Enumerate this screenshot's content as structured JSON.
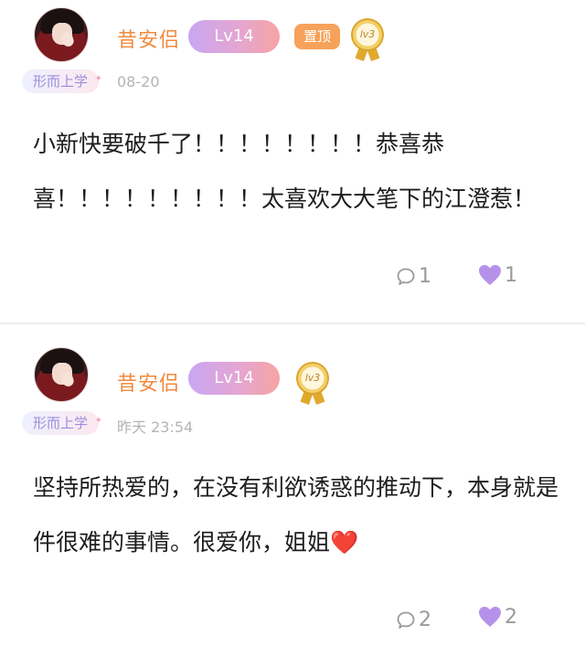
{
  "comments": [
    {
      "username": "昔安侣",
      "level": "Lv14",
      "pin_label": "置顶",
      "medal_text": "lv3",
      "tag": "形而上学",
      "time": "08-20",
      "text": "小新快要破千了！！！！！！！！恭喜恭喜！！！！！！！！！太喜欢大大笔下的江澄惹！",
      "reply_count": "1",
      "like_count": "1"
    },
    {
      "username": "昔安侣",
      "level": "Lv14",
      "medal_text": "lv3",
      "tag": "形而上学",
      "time": "昨天 23:54",
      "text": "坚持所热爱的，在没有利欲诱惑的推动下，本身就是件很难的事情。很爱你，姐姐❤️",
      "reply_count": "2",
      "like_count": "2"
    }
  ],
  "colors": {
    "username": "#f08a3e",
    "like": "#b691ea",
    "pin": "#f6a25a"
  }
}
